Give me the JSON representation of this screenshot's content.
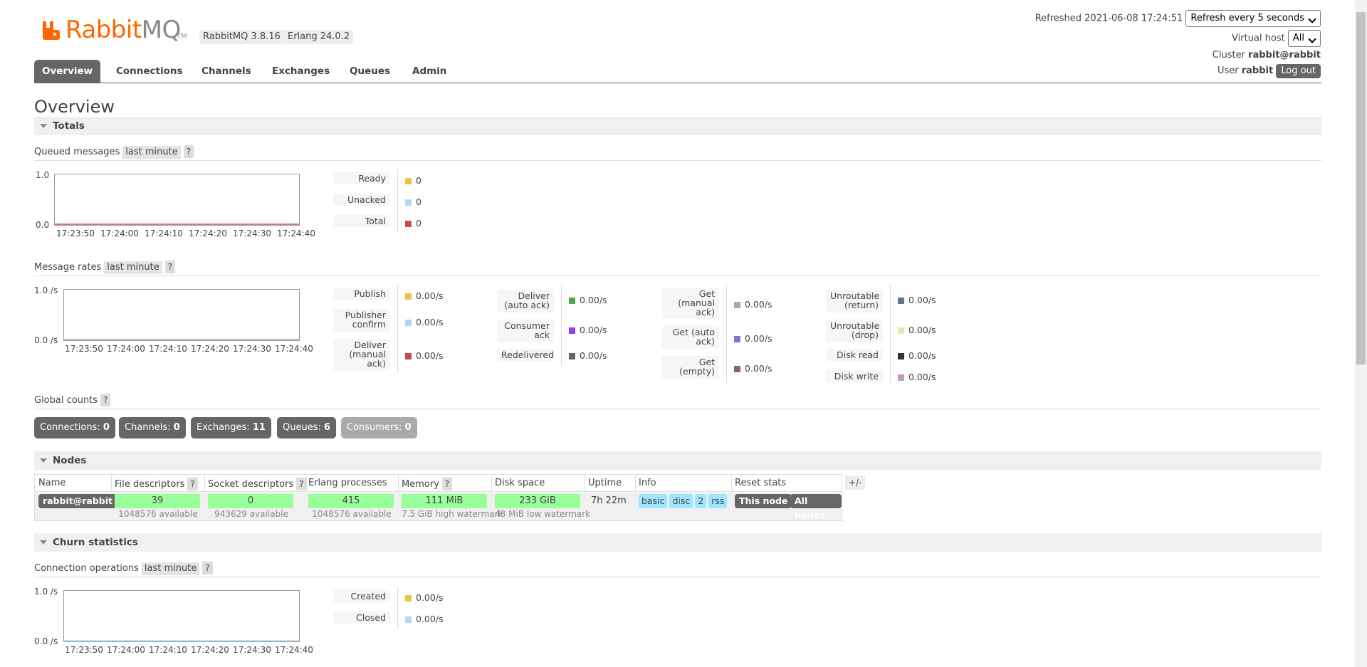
{
  "header": {
    "logo_text_a": "RabbitMQ",
    "logo_text_rabbit": "Rabbit",
    "logo_text_mq": "MQ",
    "logo_tm": "TM",
    "rabbitmq_version": "RabbitMQ 3.8.16",
    "erlang_version": "Erlang 24.0.2",
    "refreshed_label": "Refreshed 2021-06-08 17:24:51",
    "refresh_select": "Refresh every 5 seconds",
    "virtual_host_label": "Virtual host",
    "virtual_host_select": "All",
    "cluster_label": "Cluster",
    "cluster_name": "rabbit@rabbit",
    "user_label": "User",
    "user_name": "rabbit",
    "logout_label": "Log out"
  },
  "tabs": [
    {
      "label": "Overview",
      "active": true
    },
    {
      "label": "Connections"
    },
    {
      "label": "Channels"
    },
    {
      "label": "Exchanges"
    },
    {
      "label": "Queues"
    },
    {
      "label": "Admin"
    }
  ],
  "page_title": "Overview",
  "totals": {
    "section_label": "Totals",
    "queued": {
      "label": "Queued messages",
      "range": "last minute",
      "help": "?",
      "y_top": "1.0",
      "y_bottom": "0.0",
      "x_ticks": [
        "17:23:50",
        "17:24:00",
        "17:24:10",
        "17:24:20",
        "17:24:30",
        "17:24:40"
      ],
      "legend": [
        {
          "label": "Ready",
          "value": "0",
          "color": "#edc240"
        },
        {
          "label": "Unacked",
          "value": "0",
          "color": "#afd8f8"
        },
        {
          "label": "Total",
          "value": "0",
          "color": "#cb4b4b"
        }
      ]
    },
    "rates": {
      "label": "Message rates",
      "range": "last minute",
      "help": "?",
      "y_top": "1.0 /s",
      "y_bottom": "0.0 /s",
      "x_ticks": [
        "17:23:50",
        "17:24:00",
        "17:24:10",
        "17:24:20",
        "17:24:30",
        "17:24:40"
      ],
      "col1": [
        {
          "label": "Publish",
          "value": "0.00/s",
          "color": "#edc240"
        },
        {
          "label": "Publisher confirm",
          "value": "0.00/s",
          "color": "#afd8f8"
        },
        {
          "label": "Deliver (manual ack)",
          "value": "0.00/s",
          "color": "#cb4b4b"
        }
      ],
      "col2": [
        {
          "label": "Deliver (auto ack)",
          "value": "0.00/s",
          "color": "#4da74d"
        },
        {
          "label": "Consumer ack",
          "value": "0.00/s",
          "color": "#9440ed"
        },
        {
          "label": "Redelivered",
          "value": "0.00/s",
          "color": "#666666"
        }
      ],
      "col3": [
        {
          "label": "Get (manual ack)",
          "value": "0.00/s",
          "color": "#aaaaaa"
        },
        {
          "label": "Get (auto ack)",
          "value": "0.00/s",
          "color": "#7c79c3"
        },
        {
          "label": "Get (empty)",
          "value": "0.00/s",
          "color": "#8d6666"
        }
      ],
      "col4": [
        {
          "label": "Unroutable (return)",
          "value": "0.00/s",
          "color": "#5e7489"
        },
        {
          "label": "Unroutable (drop)",
          "value": "0.00/s",
          "color": "#e6e6b4"
        },
        {
          "label": "Disk read",
          "value": "0.00/s",
          "color": "#333333"
        },
        {
          "label": "Disk write",
          "value": "0.00/s",
          "color": "#c39bc3"
        }
      ]
    },
    "global": {
      "label": "Global counts",
      "help": "?",
      "counts": [
        {
          "label": "Connections:",
          "value": "0"
        },
        {
          "label": "Channels:",
          "value": "0"
        },
        {
          "label": "Exchanges:",
          "value": "11"
        },
        {
          "label": "Queues:",
          "value": "6"
        },
        {
          "label": "Consumers:",
          "value": "0"
        }
      ]
    }
  },
  "nodes": {
    "section_label": "Nodes",
    "columns": [
      "Name",
      "File descriptors",
      "Socket descriptors",
      "Erlang processes",
      "Memory",
      "Disk space",
      "Uptime",
      "Info",
      "Reset stats"
    ],
    "help": "?",
    "toggle": "+/-",
    "row": {
      "name": "rabbit@rabbit",
      "fd": "39",
      "fd_note": "1048576 available",
      "sockets": "0",
      "sockets_note": "943629 available",
      "procs": "415",
      "procs_note": "1048576 available",
      "memory": "111 MiB",
      "memory_note": "7.5 GiB high watermark",
      "disk": "233 GiB",
      "disk_note": "48 MiB low watermark",
      "uptime": "7h 22m",
      "info": [
        "basic",
        "disc",
        "2",
        "rss"
      ],
      "reset_this": "This node",
      "reset_all": "All nodes"
    }
  },
  "churn": {
    "section_label": "Churn statistics",
    "conn_ops": {
      "label": "Connection operations",
      "range": "last minute",
      "help": "?",
      "y_top": "1.0 /s",
      "y_bottom": "0.0 /s",
      "x_ticks": [
        "17:23:50",
        "17:24:00",
        "17:24:10",
        "17:24:20",
        "17:24:30",
        "17:24:40"
      ],
      "legend": [
        {
          "label": "Created",
          "value": "0.00/s",
          "color": "#edc240"
        },
        {
          "label": "Closed",
          "value": "0.00/s",
          "color": "#afd8f8"
        }
      ]
    }
  }
}
